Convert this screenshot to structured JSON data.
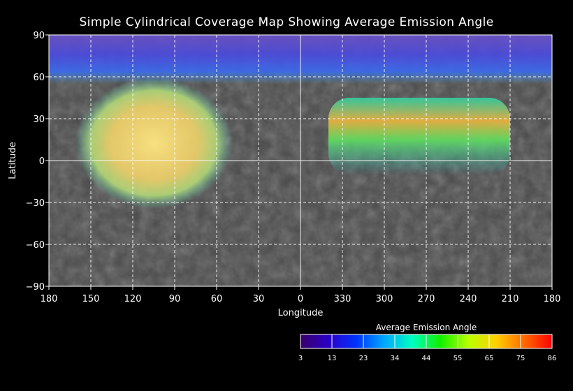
{
  "chart_data": {
    "type": "heatmap",
    "title": "Simple Cylindrical Coverage Map Showing Average Emission Angle",
    "xlabel": "Longitude",
    "ylabel": "Latitude",
    "x_tick_labels": [
      "180",
      "150",
      "120",
      "90",
      "60",
      "30",
      "0",
      "330",
      "300",
      "270",
      "240",
      "210",
      "180"
    ],
    "y_tick_labels": [
      "90",
      "60",
      "30",
      "0",
      "−30",
      "−60",
      "−90"
    ],
    "xlim": [
      180,
      -180
    ],
    "ylim": [
      -90,
      90
    ],
    "grid": true,
    "colorbar": {
      "title": "Average Emission Angle",
      "tick_labels": [
        "3",
        "13",
        "23",
        "34",
        "44",
        "55",
        "65",
        "75",
        "86"
      ],
      "min": 3,
      "max": 86,
      "colors": [
        "#3a006a",
        "#2a00c8",
        "#0033ff",
        "#00a8ff",
        "#00ffc0",
        "#10f000",
        "#b8ff00",
        "#ffd000",
        "#ff6a00",
        "#ff0000"
      ]
    },
    "coverage_regions": [
      {
        "name": "north-polar-cap",
        "lon_range": [
          180,
          -180
        ],
        "lat_range": [
          90,
          55
        ],
        "emission_angle": 10
      },
      {
        "name": "western-yellow-blob",
        "lon_range": [
          150,
          60
        ],
        "lat_range": [
          50,
          -25
        ],
        "emission_angle": 65
      },
      {
        "name": "eastern-rainbow-band",
        "lon_range": [
          -20,
          -150
        ],
        "lat_range": [
          45,
          -10
        ],
        "emission_angle": 50
      }
    ]
  }
}
